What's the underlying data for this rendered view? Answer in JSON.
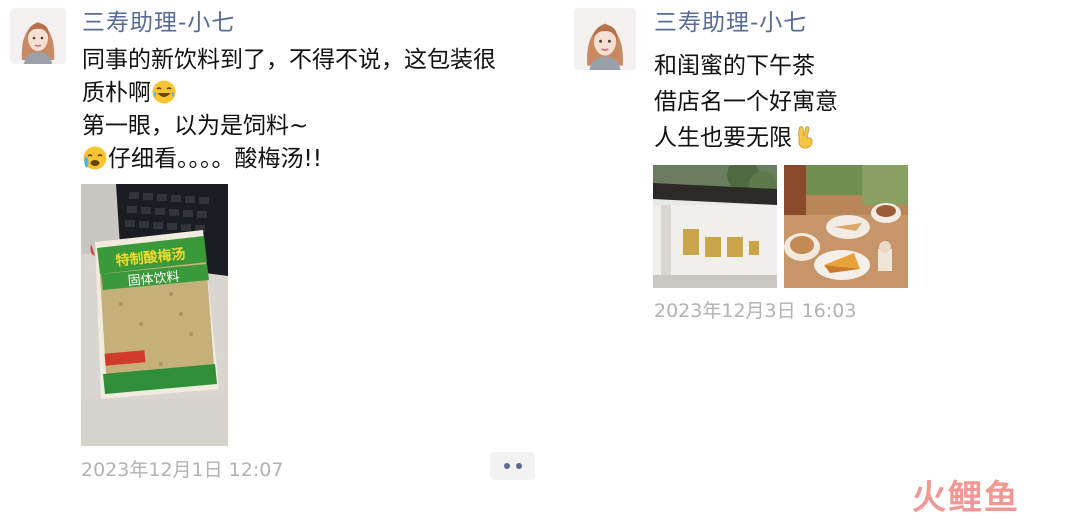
{
  "posts": [
    {
      "author": "三寿助理-小七",
      "lines": [
        {
          "text": "同事的新饮料到了，不得不说，这包装很",
          "emoji_after": null
        },
        {
          "text": "质朴啊",
          "emoji_after": "laughing-tears-emoji"
        },
        {
          "text": "第一眼，以为是饲料~",
          "emoji_after": null
        },
        {
          "emoji_before": "crying-emoji",
          "text": "仔细看。。。。酸梅汤!!"
        }
      ],
      "photo": {
        "package_line1": "特制酸梅汤",
        "package_line2": "固体饮料"
      },
      "timestamp": "2023年12月1日 12:07"
    },
    {
      "author": "三寿助理-小七",
      "lines": [
        {
          "text": "和闺蜜的下午茶",
          "emoji_after": null
        },
        {
          "text": "借店名一个好寓意",
          "emoji_after": null
        },
        {
          "text": "人生也要无限",
          "emoji_after": "victory-hand-emoji"
        }
      ],
      "timestamp": "2023年12月3日 16:03"
    }
  ],
  "watermark": {
    "part1": "火",
    "part2": "鲤鱼"
  },
  "colors": {
    "author": "#576b95",
    "timestamp": "#b2b2b2",
    "more_dots": "#576b95",
    "watermark": "#e9443d"
  }
}
